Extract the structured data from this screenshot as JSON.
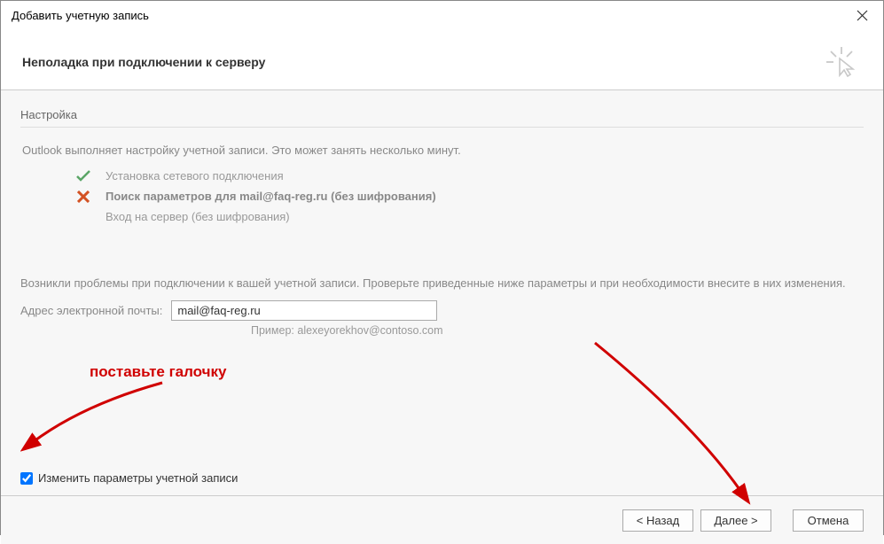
{
  "titlebar": {
    "title": "Добавить учетную запись"
  },
  "header": {
    "title": "Неполадка при подключении к серверу"
  },
  "content": {
    "section_label": "Настройка",
    "intro": "Outlook выполняет настройку учетной записи. Это может занять несколько минут.",
    "steps": {
      "s1": "Установка сетевого подключения",
      "s2_prefix": "Поиск параметров для ",
      "s2_email": "mail@faq-reg.ru",
      "s2_suffix": " (без шифрования)",
      "s3": "Вход на сервер (без шифрования)"
    },
    "problem": "Возникли проблемы при подключении к вашей учетной записи. Проверьте приведенные ниже параметры и при необходимости внесите в них изменения.",
    "email_label": "Адрес электронной почты:",
    "email_value": "mail@faq-reg.ru",
    "email_example": "Пример: alexeyorekhov@contoso.com",
    "checkbox_label": "Изменить параметры учетной записи"
  },
  "annotation": {
    "text": "поставьте галочку"
  },
  "footer": {
    "back": "< Назад",
    "next": "Далее >",
    "cancel": "Отмена"
  }
}
